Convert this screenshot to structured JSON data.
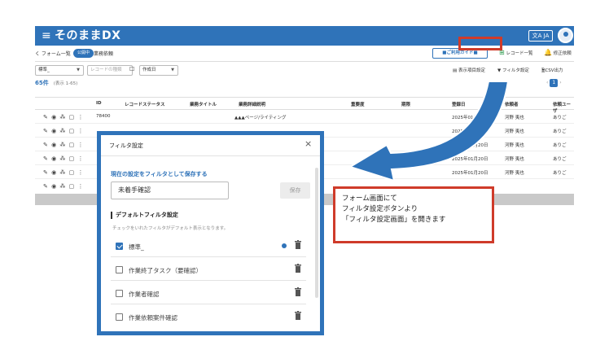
{
  "app": {
    "title": "そのままDX",
    "lang": "文A JA"
  },
  "breadcrumb": {
    "back": "く フォーム一覧",
    "badge": "公開中",
    "current": "業務依頼"
  },
  "toolbar": {
    "guide_label": "■ご利用ガイド■",
    "record_list_label": "レコード一覧",
    "record_list_icon": "grid-icon",
    "bell_label": "修正依頼",
    "bell_icon": "bell-icon"
  },
  "filters": {
    "select1": "標準_",
    "keyword_placeholder": "レコードの種類",
    "date_label": "作成日",
    "display_settings": "表示項目設定",
    "filter_settings": "フィルタ設定",
    "csv": "CSV出力"
  },
  "list": {
    "count": "65件",
    "range": "(表示 1-65)",
    "page": "1",
    "columns": [
      "ID",
      "レコードステータス",
      "業務タイトル",
      "業務詳細説明",
      "重要度",
      "期限",
      "登録日",
      "依頼者",
      "依頼ユーザ"
    ],
    "rows": [
      {
        "id": "78400",
        "detail": "▲▲▲ページ/ライティング",
        "date": "2025年01月20日",
        "requester": "河野 夷也",
        "user": "ありご"
      },
      {
        "id": "",
        "detail": "",
        "date": "2025年01月20日",
        "requester": "河野 夷也",
        "user": "ありご"
      },
      {
        "id": "",
        "detail": "",
        "date": "2025年01月20日",
        "requester": "河野 夷也",
        "user": "ありご"
      },
      {
        "id": "",
        "detail": "",
        "date": "2025年01月20日",
        "requester": "河野 夷也",
        "user": "ありご"
      },
      {
        "id": "",
        "detail": "",
        "date": "2025年01月20日",
        "requester": "河野 夷也",
        "user": "ありご"
      }
    ]
  },
  "modal": {
    "title": "フィルタ設定",
    "close": "×",
    "save_section": "現在の設定をフィルタとして保存する",
    "input_value": "未着手確認",
    "save_button": "保存",
    "default_section": "デフォルトフィルタ設定",
    "default_desc": "チェックをいれたフィルタがデフォルト表示となります。",
    "items": [
      {
        "label": "標準_",
        "checked": true
      },
      {
        "label": "作業終了タスク（要確認）",
        "checked": false
      },
      {
        "label": "作業者確認",
        "checked": false
      },
      {
        "label": "作業依頼案件確認",
        "checked": false
      }
    ]
  },
  "callout": {
    "line1": "フォーム画面にて",
    "line2": "フィルタ設定ボタンより",
    "line3": "「フィルタ設定画面」を開きます"
  },
  "colors": {
    "primary": "#2f73b9",
    "highlight": "#cf3b2a"
  }
}
